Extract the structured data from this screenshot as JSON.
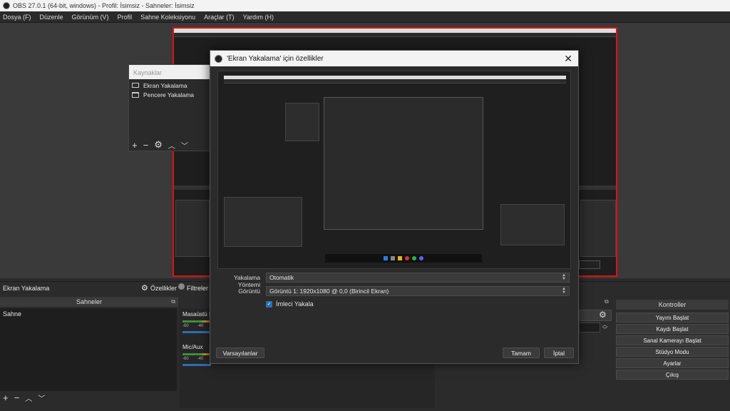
{
  "window": {
    "title": "OBS 27.0.1 (64-bit, windows) - Profil: İsimsiz - Sahneler: İsimsiz"
  },
  "menu": [
    "Dosya (F)",
    "Düzenle",
    "Görünüm (V)",
    "Profil",
    "Sahne Koleksiyonu",
    "Araçlar (T)",
    "Yardım (H)"
  ],
  "sources_dock": {
    "title": "Kaynaklar",
    "items": [
      "Ekran Yakalama",
      "Pencere Yakalama"
    ]
  },
  "dialog": {
    "title": "'Ekran Yakalama' için özellikler",
    "capture_method_label": "Yakalama Yöntemi",
    "capture_method_value": "Otomatik",
    "display_label": "Görüntü",
    "display_value": "Görüntü 1: 1920x1080 @ 0,0 (Birincil Ekran)",
    "cursor_label": "İmleci Yakala",
    "defaults_button": "Varsayılanlar",
    "ok_button": "Tamam",
    "cancel_button": "İptal"
  },
  "source_toolbar": {
    "selected_source": "Ekran Yakalama",
    "properties_label": "Özellikler",
    "filters_label": "Filtreler"
  },
  "scenes": {
    "title": "Sahneler",
    "items": [
      "Sahne"
    ]
  },
  "mixer": {
    "channels": [
      {
        "name": "Masaüstü Ses",
        "left_mark": "-60",
        "right_mark": "-40"
      },
      {
        "name": "Mic/Aux",
        "left_mark": "-60",
        "right_mark": "-40"
      }
    ]
  },
  "controls": {
    "title": "Kontroller",
    "buttons": [
      "Yayını Başlat",
      "Kaydı Başlat",
      "Sanal Kamerayı Başlat",
      "Stüdyo Modu",
      "Ayarlar",
      "Çıkış"
    ]
  }
}
